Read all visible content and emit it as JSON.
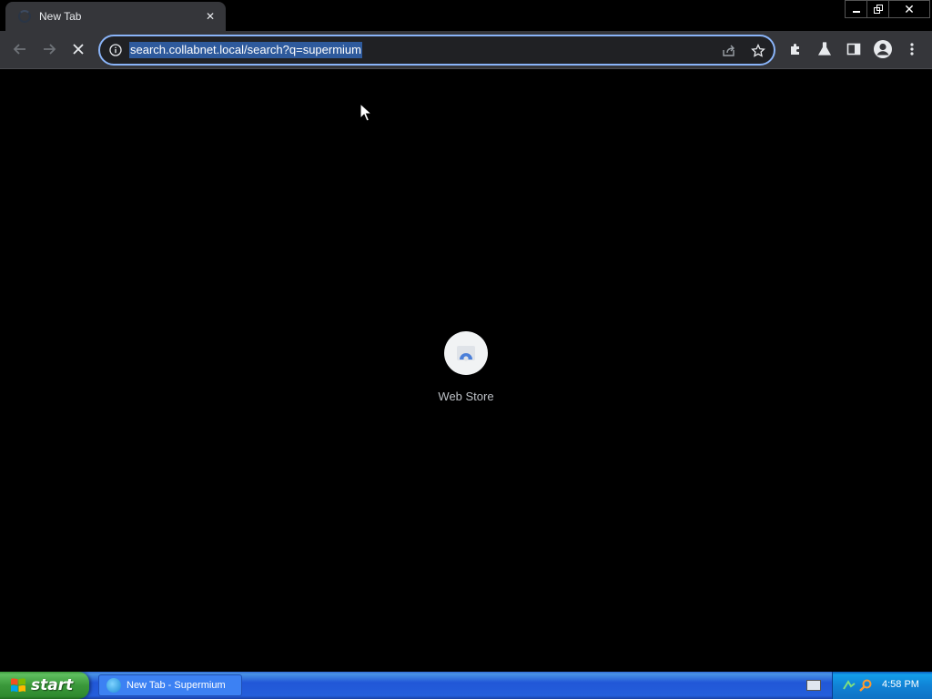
{
  "browser": {
    "tab": {
      "title": "New Tab",
      "close_glyph": "✕"
    },
    "window_controls": {
      "minimize": "–",
      "restore": "❐",
      "close": "✕"
    },
    "toolbar": {
      "back_icon": "arrow-left-icon",
      "forward_icon": "arrow-right-icon",
      "stop_icon": "stop-loading-icon",
      "url": "search.collabnet.local/search?q=supermium",
      "accent_color": "#8ab4f8",
      "selection_color": "#2e5a9c"
    }
  },
  "new_tab_page": {
    "shortcuts": [
      {
        "label": "Web Store",
        "icon": "web-store-icon"
      }
    ]
  },
  "taskbar": {
    "start_label": "start",
    "tasks": [
      {
        "label": "New Tab - Supermium",
        "icon": "browser-icon"
      }
    ],
    "clock": "4:58 PM"
  }
}
